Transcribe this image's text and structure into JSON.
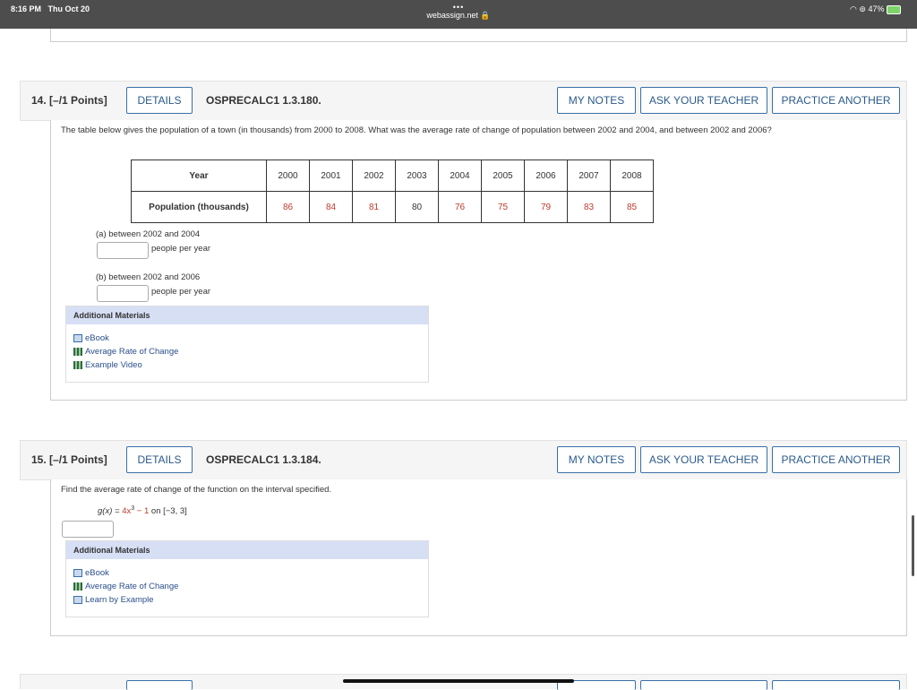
{
  "statusbar": {
    "time": "8:16 PM",
    "date": "Thu Oct 20",
    "dots": "•••",
    "url": "webassign.net 🔒",
    "battery": "47%",
    "wifi_icon": "wifi-icon"
  },
  "q14": {
    "number": "14.",
    "points": "[–/1 Points]",
    "details": "DETAILS",
    "code": "OSPRECALC1 1.3.180.",
    "my_notes": "MY NOTES",
    "ask_teacher": "ASK YOUR TEACHER",
    "practice": "PRACTICE ANOTHER",
    "prompt": "The table below gives the population of a town (in thousands) from 2000 to 2008. What was the average rate of change of population between 2002 and 2004, and between 2002 and 2006?",
    "table": {
      "row1_header": "Year",
      "years": [
        "2000",
        "2001",
        "2002",
        "2003",
        "2004",
        "2005",
        "2006",
        "2007",
        "2008"
      ],
      "row2_header": "Population (thousands)",
      "values": [
        "86",
        "84",
        "81",
        "80",
        "76",
        "75",
        "79",
        "83",
        "85"
      ],
      "red_flags": [
        true,
        true,
        true,
        false,
        true,
        true,
        true,
        true,
        true
      ]
    },
    "part_a_label": "(a) between 2002 and 2004",
    "part_a_value": "",
    "part_b_label": "(b) between 2002 and 2006",
    "part_b_value": "",
    "unit": "people per year",
    "additional": "Additional Materials",
    "resources": [
      "eBook",
      "Average Rate of Change",
      "Example Video"
    ]
  },
  "q15": {
    "number": "15.",
    "points": "[–/1 Points]",
    "details": "DETAILS",
    "code": "OSPRECALC1 1.3.184.",
    "my_notes": "MY NOTES",
    "ask_teacher": "ASK YOUR TEACHER",
    "practice": "PRACTICE ANOTHER",
    "prompt": "Find the average rate of change of the function on the interval specified.",
    "function_lhs": "g(x) = ",
    "function_coef": "4x",
    "function_exp": "3",
    "function_minus": " − ",
    "function_const": "1",
    "function_interval": " on  [−3, 3]",
    "answer_value": "",
    "additional": "Additional Materials",
    "resources": [
      "eBook",
      "Average Rate of Change",
      "Learn by Example"
    ]
  },
  "colors": {
    "accent": "#2a5a8c",
    "highlight_red": "#c0392b",
    "header_bg": "#d7dff5"
  }
}
